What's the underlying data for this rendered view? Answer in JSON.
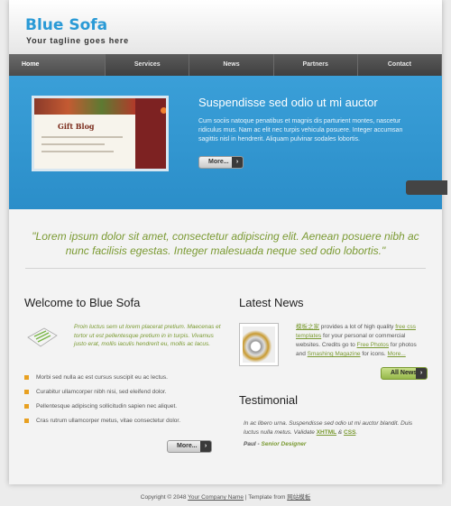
{
  "header": {
    "logo": "Blue Sofa",
    "tagline": "Your tagline goes here"
  },
  "nav": {
    "items": [
      {
        "label": "Home",
        "active": true
      },
      {
        "label": "Services"
      },
      {
        "label": "News"
      },
      {
        "label": "Partners"
      },
      {
        "label": "Contact"
      }
    ]
  },
  "hero": {
    "image_title": "Gift Blog",
    "heading": "Suspendisse sed odio ut mi auctor",
    "text": "Cum sociis natoque penatibus et magnis dis parturient montes, nascetur ridiculus mus. Nam ac elit nec turpis vehicula posuere. Integer accumsan sagittis nisl in hendrerit. Aliquam pulvinar sodales lobortis.",
    "more_label": "More...",
    "more_arrow": "›"
  },
  "quote": "\"Lorem ipsum dolor sit amet, consectetur adipiscing elit. Aenean posuere nibh ac nunc facilisis egestas. Integer malesuada neque sed odio lobortis.\"",
  "welcome": {
    "heading": "Welcome to Blue Sofa",
    "text": "Proin luctus sem ut lorem placerat pretium. Maecenas et tortor ut est pellentesque pretium in in turpis. Vivamus justo erat, mollis iaculis hendrerit eu, mollis ac lacus.",
    "bullets": [
      "Morbi sed nulla ac est cursus suscipit eu ac lectus.",
      "Curabitur ullamcorper nibh nisi, sed eleifend dolor.",
      "Pellentesque adipiscing sollicitudin sapien nec aliquet.",
      "Cras rutrum ullamcorper metus, vitae consectetur dolor."
    ],
    "more_label": "More..."
  },
  "news": {
    "heading": "Latest News",
    "link1": "模板之家",
    "text1": " provides a lot of high quality ",
    "link2": "free css templates",
    "text2": " for your personal or commercial websites. Credits go to ",
    "link3": "Free Photos",
    "text3": " for photos and ",
    "link4": "Smashing Magazine",
    "text4": " for icons. ",
    "link5": "More...",
    "all_news_label": "All News"
  },
  "testimonial": {
    "heading": "Testimonial",
    "text": "In ac libero urna. Suspendisse sed odio ut mi auctor blandit. Duis luctus nulla metus. Validate ",
    "xhtml": "XHTML",
    "and": " & ",
    "css": "CSS",
    "end": ".",
    "author": "Paul",
    "sep": " - ",
    "role": "Senior Designer"
  },
  "footer": {
    "prefix": "Copyright © 2048 ",
    "company": "Your Company Name",
    "middle": " | Template from ",
    "source": "网站模板"
  },
  "colors": {
    "brand": "#2a9ad6",
    "accent_green": "#7a9a32",
    "hero_blue": "#3a9fd8",
    "nav_dark": "#4c4c4c",
    "bullet_orange": "#e8a020"
  }
}
